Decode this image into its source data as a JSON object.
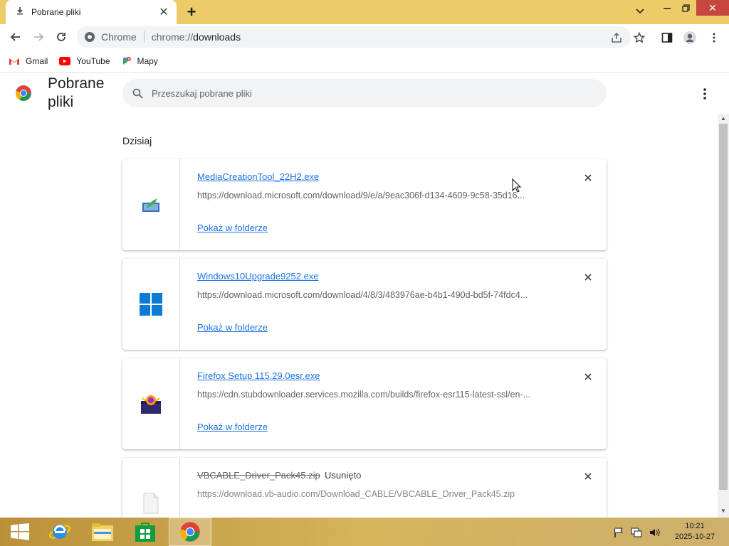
{
  "browser": {
    "tab_title": "Pobrane pliki",
    "omnibox_site": "Chrome",
    "omnibox_url_scheme": "chrome://",
    "omnibox_url_path": "downloads"
  },
  "bookmarks": [
    {
      "label": "Gmail",
      "icon": "gmail-icon"
    },
    {
      "label": "YouTube",
      "icon": "youtube-icon"
    },
    {
      "label": "Mapy",
      "icon": "maps-icon"
    }
  ],
  "page": {
    "title": "Pobrane pliki",
    "search_placeholder": "Przeszukaj pobrane pliki",
    "section_label": "Dzisiaj"
  },
  "downloads": [
    {
      "name": "MediaCreationTool_22H2.exe",
      "url": "https://download.microsoft.com/download/9/e/a/9eac306f-d134-4609-9c58-35d16...",
      "action": "Pokaż w folderze",
      "icon": "media-creation-tool-icon",
      "status": ""
    },
    {
      "name": "Windows10Upgrade9252.exe",
      "url": "https://download.microsoft.com/download/4/8/3/483976ae-b4b1-490d-bd5f-74fdc4...",
      "action": "Pokaż w folderze",
      "icon": "windows-logo-icon",
      "status": ""
    },
    {
      "name": "Firefox Setup 115.29.0esr.exe",
      "url": "https://cdn.stubdownloader.services.mozilla.com/builds/firefox-esr115-latest-ssl/en-...",
      "action": "Pokaż w folderze",
      "icon": "installer-box-icon",
      "status": ""
    },
    {
      "name": "VBCABLE_Driver_Pack45.zip",
      "url": "https://download.vb-audio.com/Download_CABLE/VBCABLE_Driver_Pack45.zip",
      "action": "",
      "icon": "zip-file-icon",
      "status": "Usunięto"
    }
  ],
  "taskbar": {
    "time": "10:21",
    "date": "2025-10-27"
  },
  "colors": {
    "titlebar": "#eccb68",
    "link": "#1a73e8",
    "close_button": "#c7463f"
  }
}
